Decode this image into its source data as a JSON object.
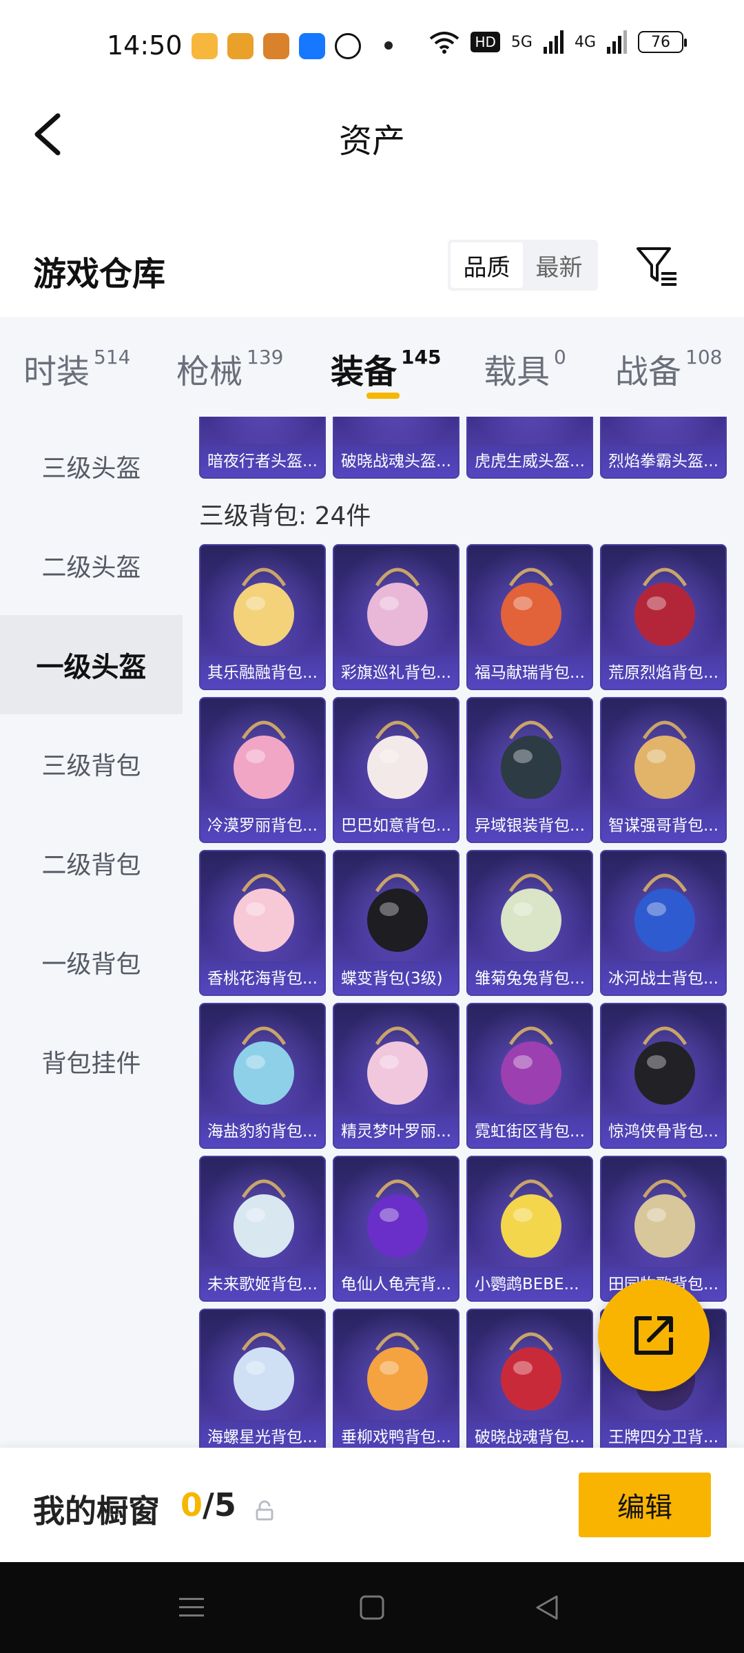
{
  "status_bar": {
    "time": "14:50",
    "network": "HD",
    "network_5g": "5G",
    "network_4g": "4G",
    "battery": "76"
  },
  "header": {
    "title": "资产"
  },
  "warehouse": {
    "title": "游戏仓库",
    "sort_options": [
      "品质",
      "最新"
    ],
    "active_sort": "品质"
  },
  "categories": [
    {
      "name": "时装",
      "count": "514"
    },
    {
      "name": "枪械",
      "count": "139"
    },
    {
      "name": "装备",
      "count": "145"
    },
    {
      "name": "载具",
      "count": "0"
    },
    {
      "name": "战备",
      "count": "108"
    }
  ],
  "active_category": "装备",
  "sidebar": {
    "items": [
      "三级头盔",
      "二级头盔",
      "一级头盔",
      "三级背包",
      "二级背包",
      "一级背包",
      "背包挂件"
    ],
    "active": "一级头盔"
  },
  "partial_row": [
    "暗夜行者头盔...",
    "破晓战魂头盔...",
    "虎虎生威头盔...",
    "烈焰拳霸头盔..."
  ],
  "section": {
    "title": "三级背包: 24件"
  },
  "items": [
    {
      "label": "其乐融融背包...",
      "color": "#f3d27a"
    },
    {
      "label": "彩旗巡礼背包...",
      "color": "#e9b8d8"
    },
    {
      "label": "福马献瑞背包...",
      "color": "#e2623a"
    },
    {
      "label": "荒原烈焰背包...",
      "color": "#b3263a"
    },
    {
      "label": "冷漠罗丽背包...",
      "color": "#f2a6c6"
    },
    {
      "label": "巴巴如意背包...",
      "color": "#f4e9e9"
    },
    {
      "label": "异域银装背包...",
      "color": "#2d3b44"
    },
    {
      "label": "智谋强哥背包...",
      "color": "#e1b46a"
    },
    {
      "label": "香桃花海背包...",
      "color": "#f7c9d6"
    },
    {
      "label": "蝶变背包(3级)",
      "color": "#1d1d22"
    },
    {
      "label": "雏菊兔兔背包...",
      "color": "#d9e5c6"
    },
    {
      "label": "冰河战士背包...",
      "color": "#2e5bd0"
    },
    {
      "label": "海盐豹豹背包...",
      "color": "#8ed0e8"
    },
    {
      "label": "精灵梦叶罗丽...",
      "color": "#f1c7dd"
    },
    {
      "label": "霓虹街区背包...",
      "color": "#9c3fb0"
    },
    {
      "label": "惊鸿侠骨背包...",
      "color": "#222226"
    },
    {
      "label": "未来歌姬背包...",
      "color": "#d9e7f1"
    },
    {
      "label": "龟仙人龟壳背...",
      "color": "#6a2fc8"
    },
    {
      "label": "小鹦鹉BEBE...",
      "color": "#f3d64b"
    },
    {
      "label": "田园牧歌背包...",
      "color": "#d8c79a"
    },
    {
      "label": "海螺星光背包...",
      "color": "#cfe0f5"
    },
    {
      "label": "垂柳戏鸭背包...",
      "color": "#f4a340"
    },
    {
      "label": "破晓战魂背包...",
      "color": "#c92a3a"
    },
    {
      "label": "王牌四分卫背...",
      "color": "#3b2a6a"
    }
  ],
  "showcase": {
    "label": "我的橱窗",
    "current": "0",
    "total": "/5",
    "edit_label": "编辑"
  },
  "colors": {
    "accent": "#f8b400",
    "card_bg": "#3d2f8a"
  },
  "icons": [
    "back-arrow-icon",
    "filter-icon",
    "share-icon",
    "lock-icon",
    "menu-icon",
    "home-icon",
    "back-icon"
  ]
}
